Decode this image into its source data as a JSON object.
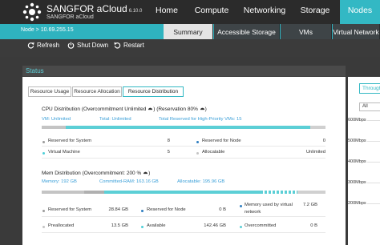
{
  "app": {
    "brand": "SANGFOR aCloud",
    "version": "6.10.0",
    "subtitle": "SANGFOR aCloud"
  },
  "nav": {
    "items": [
      {
        "label": "Home"
      },
      {
        "label": "Compute"
      },
      {
        "label": "Networking"
      },
      {
        "label": "Storage"
      },
      {
        "label": "Nodes"
      }
    ],
    "active": "Nodes"
  },
  "node_bar": {
    "label": "Node  > 10.69.255.15"
  },
  "tabs": [
    {
      "label": "Summary"
    },
    {
      "label": "Accessible Storage"
    },
    {
      "label": "VMs"
    },
    {
      "label": "Virtual Network"
    }
  ],
  "toolbar": {
    "refresh": "Refresh",
    "shutdown": "Shut Down",
    "restart": "Restart"
  },
  "status": {
    "title": "Status",
    "subtabs": [
      "Resource Usage",
      "Resource Allocation",
      "Resource Distribution"
    ],
    "active_subtab": "Resource Distribution"
  },
  "cpu": {
    "title": "CPU Distribution (Overcommitment Unlimited",
    "reservation": "(Reservation 80%",
    "vm": "VM: Unlimited",
    "total": "Total: Unlimited",
    "total_reserved": "Total Reserved for High-Priority VMs: 15",
    "bar": {
      "reserved_system": 0.085,
      "vm": 0.86,
      "reserved_node": 0.0
    },
    "rows": [
      {
        "label": "Reserved for System",
        "value": "8"
      },
      {
        "label": "Reserved for Node",
        "value": "0"
      },
      {
        "label": "Virtual Machine",
        "value": "5"
      },
      {
        "label": "Allocatable",
        "value": "Unlimited"
      }
    ]
  },
  "mem": {
    "title": "Mem Distribution (Overcommitment: 200 %",
    "memory": "Memory: 192 GB",
    "committed": "Committed-RAM: 163.16 GB",
    "allocatable": "Allocatable: 195.96 GB",
    "bar": {
      "reserved_system": 0.15,
      "preallocated": 0.07,
      "vm": 0.55,
      "dashed": 0.13
    },
    "rows": [
      {
        "label": "Reserved for System",
        "value": "28.84 GB"
      },
      {
        "label": "Reserved for Node",
        "value": "0 B"
      },
      {
        "label": "Memory used by virtual network",
        "value": "7.2 GB"
      },
      {
        "label": "Preallocated",
        "value": "13.5 GB"
      },
      {
        "label": "Available",
        "value": "142.46 GB"
      },
      {
        "label": "Overcommitted",
        "value": "0 B"
      }
    ]
  },
  "right_panel": {
    "button": "Throughput",
    "select": "All",
    "ticks": [
      "600Mbps",
      "500Mbps",
      "400Mbps",
      "300Mbps",
      "200Mbps"
    ]
  },
  "colors": {
    "accent": "#2fb3bf",
    "header_bg": "#2b2b2b",
    "link_blue": "#3a9fd8",
    "bar_gray": "#c4c4c4",
    "bar_teal": "#5ccfd6",
    "dot_gray": "#9a9a9a",
    "dot_blue": "#2f7fc1",
    "dot_teal": "#4fd0d8"
  }
}
